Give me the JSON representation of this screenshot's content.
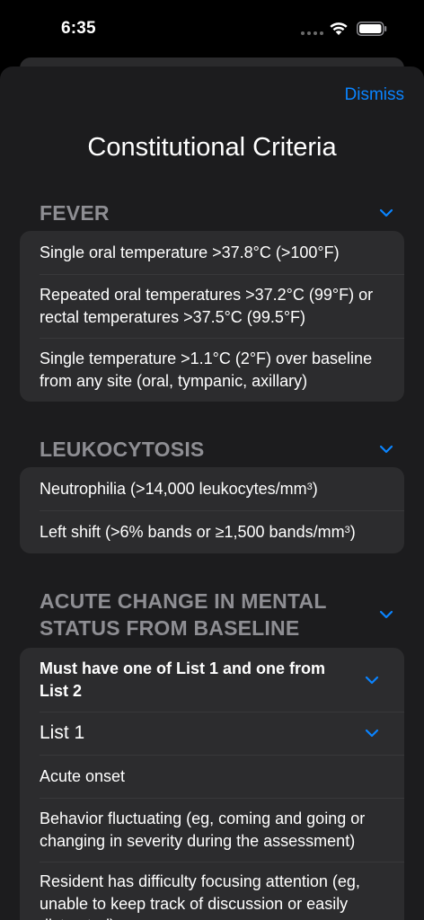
{
  "status_bar": {
    "time": "6:35"
  },
  "sheet": {
    "dismiss_label": "Dismiss",
    "title": "Constitutional Criteria"
  },
  "sections": [
    {
      "title": "FEVER",
      "items": [
        "Single oral temperature >37.8°C (>100°F)",
        "Repeated oral temperatures >37.2°C (99°F) or rectal temperatures >37.5°C (99.5°F)",
        "Single temperature >1.1°C (2°F) over baseline from any site (oral, tympanic, axillary)"
      ]
    },
    {
      "title": "LEUKOCYTOSIS",
      "items": [
        {
          "text": "Neutrophilia (>14,000 leukocytes/mm",
          "sup": "3",
          "after": ")"
        },
        {
          "text": "Left shift (>6% bands or ≥1,500 bands/mm",
          "sup": "3",
          "after": ")"
        }
      ]
    },
    {
      "title": "ACUTE CHANGE IN MENTAL STATUS FROM BASELINE",
      "rule_label": "Must have one of List 1 and one from List 2",
      "list_label": "List 1",
      "items": [
        "Acute onset",
        "Behavior fluctuating (eg, coming and going or changing in severity during the assessment)",
        "Resident has difficulty focusing attention (eg, unable to keep track of discussion or easily distracted)"
      ]
    }
  ],
  "colors": {
    "accent": "#0a84ff",
    "background": "#1c1c1e",
    "card": "#2c2c2e",
    "section_title": "#8e8e93"
  }
}
